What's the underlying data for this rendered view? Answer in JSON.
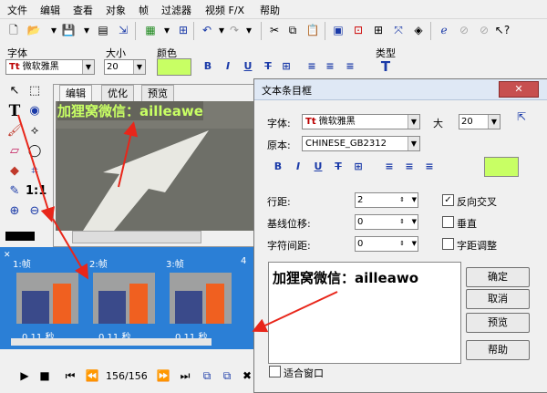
{
  "menu": [
    "文件",
    "编辑",
    "查看",
    "对象",
    "帧",
    "过滤器",
    "视频 F/X",
    "帮助"
  ],
  "toolbar2": {
    "font_label": "字体",
    "font_value": "微软雅黑",
    "size_label": "大小",
    "size_value": "20",
    "color_label": "颜色",
    "type_label": "类型",
    "color": "#c8ff64"
  },
  "editor": {
    "tabs": [
      "编辑",
      "优化",
      "预览"
    ],
    "canvas_text": "加狸窝微信：ailleawe"
  },
  "frames": [
    {
      "label": "1:帧",
      "time": "0.11 秒"
    },
    {
      "label": "2:帧",
      "time": "0.11 秒"
    },
    {
      "label": "3:帧",
      "time": "0.11 秒"
    },
    {
      "label": "4"
    }
  ],
  "playbar": {
    "counter": "156/156"
  },
  "dialog": {
    "title": "文本条目框",
    "font_label": "字体:",
    "font_value": "微软雅黑",
    "size_label": "大",
    "size_value": "20",
    "charset_label": "原本:",
    "charset_value": "CHINESE_GB2312",
    "line_spacing_label": "行距:",
    "line_spacing_value": "2",
    "baseline_label": "基线位移:",
    "baseline_value": "0",
    "char_spacing_label": "字符间距:",
    "char_spacing_value": "0",
    "antialias_label": "反向交叉",
    "vertical_label": "垂直",
    "kerning_label": "字距调整",
    "preview_text": "加狸窝微信：ailleawo",
    "ok": "确定",
    "cancel": "取消",
    "preview_btn": "预览",
    "help": "帮助",
    "fit_window": "适合窗口",
    "color": "#c8ff64"
  }
}
